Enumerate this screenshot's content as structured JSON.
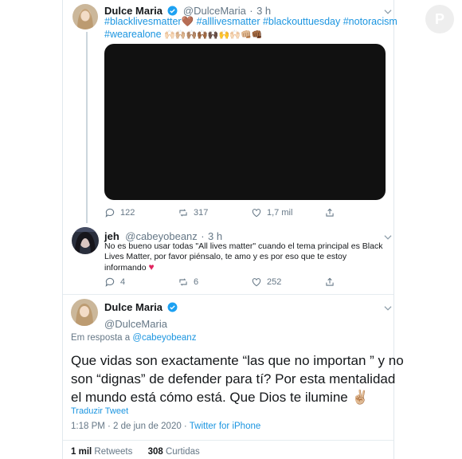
{
  "tweet1": {
    "name": "Dulce Maria",
    "handle": "@DulceMaria",
    "sep": "·",
    "time": "3 h",
    "hashtags_line1": "#blacklivesmatter🤎 #alllivesmatter #blackouttuesday #notoracism",
    "hashtags_line2_tag": "#wearealone",
    "hashtags_line2_emoji": "🙌🏻🙌🏼🙌🏽🙌🏾🙌🏿🙌🙌🏻👊🏼👊🏾",
    "stats": {
      "replies": "122",
      "retweets": "317",
      "likes": "1,7 mil"
    }
  },
  "tweet2": {
    "name": "jeh",
    "handle": "@cabeyobeanz",
    "sep": "·",
    "time": "3 h",
    "line1": "No es bueno usar todas \"All lives matter\" cuando el tema principal es Black",
    "line2": "Lives Matter, por favor piénsalo, te amo y es por eso que te estoy",
    "line3": "informando",
    "heart": "♥",
    "stats": {
      "replies": "4",
      "retweets": "6",
      "likes": "252"
    }
  },
  "tweet3": {
    "name": "Dulce Maria",
    "handle": "@DulceMaria",
    "reply_prefix": "Em resposta a",
    "reply_to": "@cabeyobeanz",
    "line1": "Que vidas son exactamente “las que no importan ” y no",
    "line2": "son “dignas” de defender para tí? Por esta mentalidad",
    "line3": "el mundo está cómo está. Que Dios te ilumine",
    "emoji": "✌🏼",
    "translate": "Traduzir Tweet",
    "timestamp": "1:18 PM · 2 de jun de 2020 ·",
    "source": "Twitter for iPhone",
    "retweets_count": "1 mil",
    "retweets_label": "Retweets",
    "likes_count": "308",
    "likes_label": "Curtidas"
  },
  "colors": {
    "accent": "#1b95e0",
    "muted": "#657786",
    "heart": "#e0245e"
  },
  "watermark": "P"
}
